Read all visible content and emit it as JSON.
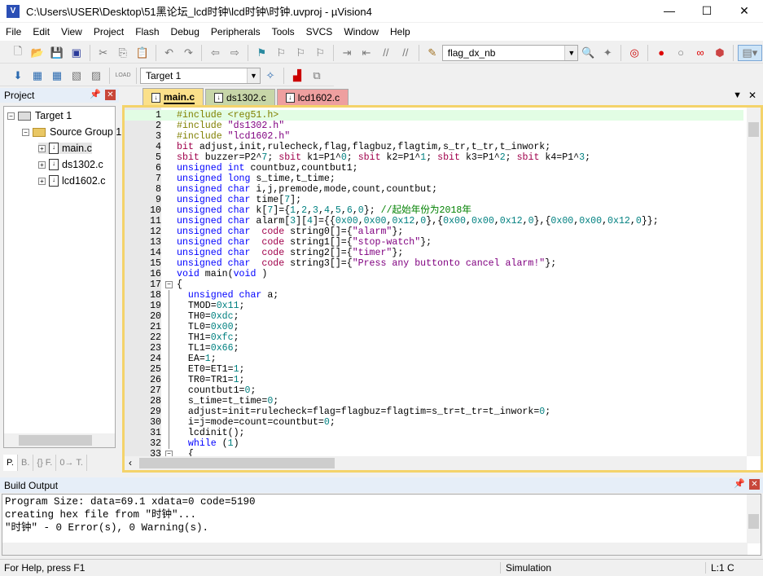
{
  "window": {
    "title": "C:\\Users\\USER\\Desktop\\51黑论坛_lcd时钟\\lcd时钟\\时钟.uvproj - µVision4",
    "minimize": "—",
    "maximize": "☐",
    "close": "✕"
  },
  "menu": [
    "File",
    "Edit",
    "View",
    "Project",
    "Flash",
    "Debug",
    "Peripherals",
    "Tools",
    "SVCS",
    "Window",
    "Help"
  ],
  "toolbar": {
    "find_combo": "flag_dx_nb",
    "target_combo": "Target 1"
  },
  "project_panel": {
    "title": "Project",
    "tree": {
      "target": "Target 1",
      "group": "Source Group 1",
      "files": [
        "main.c",
        "ds1302.c",
        "lcd1602.c"
      ]
    },
    "tabs": [
      "P.",
      "B.",
      "{} F.",
      "0→ T."
    ]
  },
  "editor": {
    "tabs": [
      {
        "label": "main.c",
        "color": "#fbe08a",
        "active": true
      },
      {
        "label": "ds1302.c",
        "color": "#c7d6a8"
      },
      {
        "label": "lcd1602.c",
        "color": "#ee9f9f"
      }
    ],
    "lines": [
      [
        [
          "p",
          "#include <reg51.h>"
        ]
      ],
      [
        [
          "p",
          "#include "
        ],
        [
          "s",
          "\"ds1302.h\""
        ]
      ],
      [
        [
          "p",
          "#include "
        ],
        [
          "s",
          "\"lcd1602.h\""
        ]
      ],
      [
        [
          "t",
          "bit"
        ],
        [
          "",
          "adjust,init,rulecheck,flag,flagbuz,flagtim,s_tr,t_tr,t_inwork;"
        ]
      ],
      [
        [
          "t",
          "sbit"
        ],
        [
          "",
          "buzzer=P2^"
        ],
        [
          "n",
          "7"
        ],
        [
          "",
          "; "
        ],
        [
          "t",
          "sbit"
        ],
        [
          "",
          "k1=P1^"
        ],
        [
          "n",
          "0"
        ],
        [
          "",
          "; "
        ],
        [
          "t",
          "sbit"
        ],
        [
          "",
          "k2=P1^"
        ],
        [
          "n",
          "1"
        ],
        [
          "",
          "; "
        ],
        [
          "t",
          "sbit"
        ],
        [
          "",
          "k3=P1^"
        ],
        [
          "n",
          "2"
        ],
        [
          "",
          "; "
        ],
        [
          "t",
          "sbit"
        ],
        [
          "",
          "k4=P1^"
        ],
        [
          "n",
          "3"
        ],
        [
          "",
          ";"
        ]
      ],
      [
        [
          "k",
          "unsigned int"
        ],
        [
          "",
          "countbuz,countbut1;"
        ]
      ],
      [
        [
          "k",
          "unsigned long"
        ],
        [
          "",
          "s_time,t_time;"
        ]
      ],
      [
        [
          "k",
          "unsigned char"
        ],
        [
          "",
          "i,j,premode,mode,count,countbut;"
        ]
      ],
      [
        [
          "k",
          "unsigned char"
        ],
        [
          "",
          "time["
        ],
        [
          "n",
          "7"
        ],
        [
          "",
          "];"
        ]
      ],
      [
        [
          "k",
          "unsigned char"
        ],
        [
          "",
          "k["
        ],
        [
          "n",
          "7"
        ],
        [
          "",
          "]={"
        ],
        [
          "n",
          "1"
        ],
        [
          "",
          ","
        ],
        [
          "n",
          "2"
        ],
        [
          "",
          ","
        ],
        [
          "n",
          "3"
        ],
        [
          "",
          ","
        ],
        [
          "n",
          "4"
        ],
        [
          "",
          ","
        ],
        [
          "n",
          "5"
        ],
        [
          "",
          ","
        ],
        [
          "n",
          "6"
        ],
        [
          "",
          ","
        ],
        [
          "n",
          "0"
        ],
        [
          "",
          "}; "
        ],
        [
          "c",
          "//起始年份为2018年"
        ]
      ],
      [
        [
          "k",
          "unsigned char"
        ],
        [
          "",
          "alarm["
        ],
        [
          "n",
          "3"
        ],
        [
          "",
          "]["
        ],
        [
          "n",
          "4"
        ],
        [
          "",
          "]={{"
        ],
        [
          "n",
          "0x00"
        ],
        [
          "",
          ","
        ],
        [
          "n",
          "0x00"
        ],
        [
          "",
          ","
        ],
        [
          "n",
          "0x12"
        ],
        [
          "",
          ","
        ],
        [
          "n",
          "0"
        ],
        [
          "",
          "},{"
        ],
        [
          "n",
          "0x00"
        ],
        [
          "",
          ","
        ],
        [
          "n",
          "0x00"
        ],
        [
          "",
          ","
        ],
        [
          "n",
          "0x12"
        ],
        [
          "",
          ","
        ],
        [
          "n",
          "0"
        ],
        [
          "",
          "},{"
        ],
        [
          "n",
          "0x00"
        ],
        [
          "",
          ","
        ],
        [
          "n",
          "0x00"
        ],
        [
          "",
          ","
        ],
        [
          "n",
          "0x12"
        ],
        [
          "",
          ","
        ],
        [
          "n",
          "0"
        ],
        [
          "",
          "}};"
        ]
      ],
      [
        [
          "k",
          "unsigned char"
        ],
        [
          "t",
          " code"
        ],
        [
          "",
          "string0[]={"
        ],
        [
          "s",
          "\"alarm\""
        ],
        [
          "",
          "};"
        ]
      ],
      [
        [
          "k",
          "unsigned char"
        ],
        [
          "t",
          " code"
        ],
        [
          "",
          "string1[]={"
        ],
        [
          "s",
          "\"stop-watch\""
        ],
        [
          "",
          "};"
        ]
      ],
      [
        [
          "k",
          "unsigned char"
        ],
        [
          "t",
          " code"
        ],
        [
          "",
          "string2[]={"
        ],
        [
          "s",
          "\"timer\""
        ],
        [
          "",
          "};"
        ]
      ],
      [
        [
          "k",
          "unsigned char"
        ],
        [
          "t",
          " code"
        ],
        [
          "",
          "string3[]={"
        ],
        [
          "s",
          "\"Press any buttonto cancel alarm!\""
        ],
        [
          "",
          "};"
        ]
      ],
      [
        [
          "k",
          "void"
        ],
        [
          "",
          "main("
        ],
        [
          "k",
          "void"
        ],
        [
          "",
          ")"
        ]
      ],
      [
        [
          "",
          "{"
        ]
      ],
      [
        [
          "k",
          "  unsigned char"
        ],
        [
          "",
          "a;"
        ]
      ],
      [
        [
          "",
          "  TMOD="
        ],
        [
          "n",
          "0x11"
        ],
        [
          "",
          ";"
        ]
      ],
      [
        [
          "",
          "  TH0="
        ],
        [
          "n",
          "0xdc"
        ],
        [
          "",
          ";"
        ]
      ],
      [
        [
          "",
          "  TL0="
        ],
        [
          "n",
          "0x00"
        ],
        [
          "",
          ";"
        ]
      ],
      [
        [
          "",
          "  TH1="
        ],
        [
          "n",
          "0xfc"
        ],
        [
          "",
          ";"
        ]
      ],
      [
        [
          "",
          "  TL1="
        ],
        [
          "n",
          "0x66"
        ],
        [
          "",
          ";"
        ]
      ],
      [
        [
          "",
          "  EA="
        ],
        [
          "n",
          "1"
        ],
        [
          "",
          ";"
        ]
      ],
      [
        [
          "",
          "  ET0=ET1="
        ],
        [
          "n",
          "1"
        ],
        [
          "",
          ";"
        ]
      ],
      [
        [
          "",
          "  TR0=TR1="
        ],
        [
          "n",
          "1"
        ],
        [
          "",
          ";"
        ]
      ],
      [
        [
          "",
          "  countbut1="
        ],
        [
          "n",
          "0"
        ],
        [
          "",
          ";"
        ]
      ],
      [
        [
          "",
          "  s_time=t_time="
        ],
        [
          "n",
          "0"
        ],
        [
          "",
          ";"
        ]
      ],
      [
        [
          "",
          "  adjust=init=rulecheck=flag=flagbuz=flagtim=s_tr=t_tr=t_inwork="
        ],
        [
          "n",
          "0"
        ],
        [
          "",
          ";"
        ]
      ],
      [
        [
          "",
          "  i=j=mode=count=countbut="
        ],
        [
          "n",
          "0"
        ],
        [
          "",
          ";"
        ]
      ],
      [
        [
          "",
          "  lcdinit();"
        ]
      ],
      [
        [
          "k",
          "  while"
        ],
        [
          "",
          "("
        ],
        [
          "n",
          "1"
        ],
        [
          "",
          ")"
        ]
      ],
      [
        [
          "",
          "  {"
        ]
      ]
    ]
  },
  "build_output": {
    "title": "Build Output",
    "lines": [
      "Program Size: data=69.1 xdata=0 code=5190",
      "creating hex file from \"时钟\"...",
      "\"时钟\" - 0 Error(s), 0 Warning(s)."
    ]
  },
  "status": {
    "help": "For Help, press F1",
    "mode": "Simulation",
    "position": "L:1 C"
  }
}
